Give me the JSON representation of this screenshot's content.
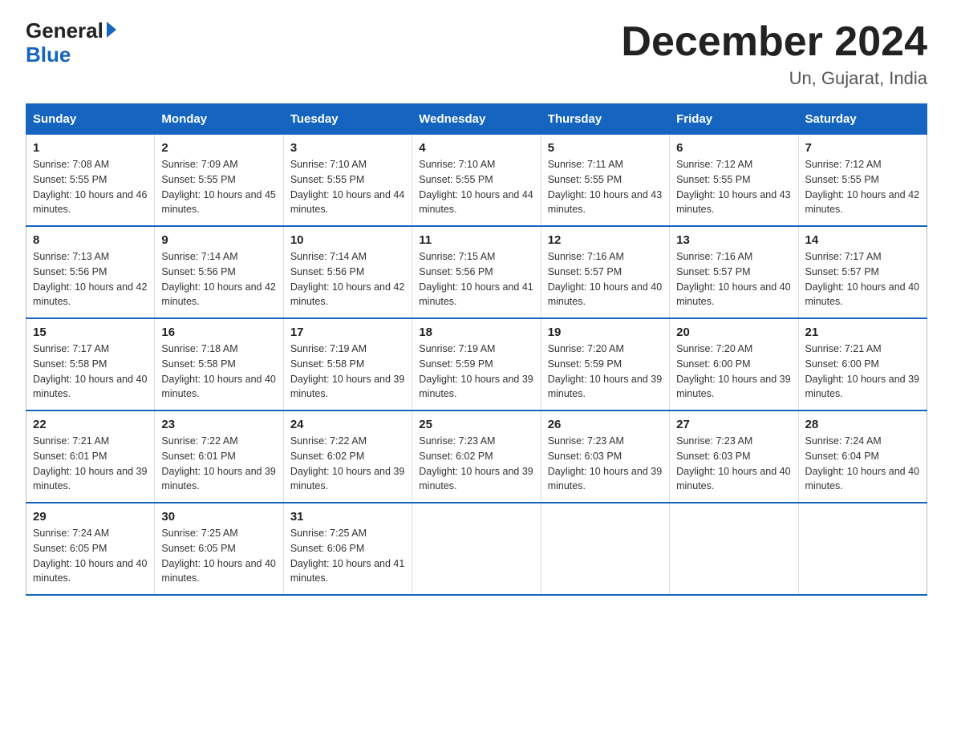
{
  "logo": {
    "general": "General",
    "blue": "Blue"
  },
  "title": "December 2024",
  "subtitle": "Un, Gujarat, India",
  "days_header": [
    "Sunday",
    "Monday",
    "Tuesday",
    "Wednesday",
    "Thursday",
    "Friday",
    "Saturday"
  ],
  "weeks": [
    [
      {
        "num": "1",
        "sunrise": "7:08 AM",
        "sunset": "5:55 PM",
        "daylight": "10 hours and 46 minutes."
      },
      {
        "num": "2",
        "sunrise": "7:09 AM",
        "sunset": "5:55 PM",
        "daylight": "10 hours and 45 minutes."
      },
      {
        "num": "3",
        "sunrise": "7:10 AM",
        "sunset": "5:55 PM",
        "daylight": "10 hours and 44 minutes."
      },
      {
        "num": "4",
        "sunrise": "7:10 AM",
        "sunset": "5:55 PM",
        "daylight": "10 hours and 44 minutes."
      },
      {
        "num": "5",
        "sunrise": "7:11 AM",
        "sunset": "5:55 PM",
        "daylight": "10 hours and 43 minutes."
      },
      {
        "num": "6",
        "sunrise": "7:12 AM",
        "sunset": "5:55 PM",
        "daylight": "10 hours and 43 minutes."
      },
      {
        "num": "7",
        "sunrise": "7:12 AM",
        "sunset": "5:55 PM",
        "daylight": "10 hours and 42 minutes."
      }
    ],
    [
      {
        "num": "8",
        "sunrise": "7:13 AM",
        "sunset": "5:56 PM",
        "daylight": "10 hours and 42 minutes."
      },
      {
        "num": "9",
        "sunrise": "7:14 AM",
        "sunset": "5:56 PM",
        "daylight": "10 hours and 42 minutes."
      },
      {
        "num": "10",
        "sunrise": "7:14 AM",
        "sunset": "5:56 PM",
        "daylight": "10 hours and 42 minutes."
      },
      {
        "num": "11",
        "sunrise": "7:15 AM",
        "sunset": "5:56 PM",
        "daylight": "10 hours and 41 minutes."
      },
      {
        "num": "12",
        "sunrise": "7:16 AM",
        "sunset": "5:57 PM",
        "daylight": "10 hours and 40 minutes."
      },
      {
        "num": "13",
        "sunrise": "7:16 AM",
        "sunset": "5:57 PM",
        "daylight": "10 hours and 40 minutes."
      },
      {
        "num": "14",
        "sunrise": "7:17 AM",
        "sunset": "5:57 PM",
        "daylight": "10 hours and 40 minutes."
      }
    ],
    [
      {
        "num": "15",
        "sunrise": "7:17 AM",
        "sunset": "5:58 PM",
        "daylight": "10 hours and 40 minutes."
      },
      {
        "num": "16",
        "sunrise": "7:18 AM",
        "sunset": "5:58 PM",
        "daylight": "10 hours and 40 minutes."
      },
      {
        "num": "17",
        "sunrise": "7:19 AM",
        "sunset": "5:58 PM",
        "daylight": "10 hours and 39 minutes."
      },
      {
        "num": "18",
        "sunrise": "7:19 AM",
        "sunset": "5:59 PM",
        "daylight": "10 hours and 39 minutes."
      },
      {
        "num": "19",
        "sunrise": "7:20 AM",
        "sunset": "5:59 PM",
        "daylight": "10 hours and 39 minutes."
      },
      {
        "num": "20",
        "sunrise": "7:20 AM",
        "sunset": "6:00 PM",
        "daylight": "10 hours and 39 minutes."
      },
      {
        "num": "21",
        "sunrise": "7:21 AM",
        "sunset": "6:00 PM",
        "daylight": "10 hours and 39 minutes."
      }
    ],
    [
      {
        "num": "22",
        "sunrise": "7:21 AM",
        "sunset": "6:01 PM",
        "daylight": "10 hours and 39 minutes."
      },
      {
        "num": "23",
        "sunrise": "7:22 AM",
        "sunset": "6:01 PM",
        "daylight": "10 hours and 39 minutes."
      },
      {
        "num": "24",
        "sunrise": "7:22 AM",
        "sunset": "6:02 PM",
        "daylight": "10 hours and 39 minutes."
      },
      {
        "num": "25",
        "sunrise": "7:23 AM",
        "sunset": "6:02 PM",
        "daylight": "10 hours and 39 minutes."
      },
      {
        "num": "26",
        "sunrise": "7:23 AM",
        "sunset": "6:03 PM",
        "daylight": "10 hours and 39 minutes."
      },
      {
        "num": "27",
        "sunrise": "7:23 AM",
        "sunset": "6:03 PM",
        "daylight": "10 hours and 40 minutes."
      },
      {
        "num": "28",
        "sunrise": "7:24 AM",
        "sunset": "6:04 PM",
        "daylight": "10 hours and 40 minutes."
      }
    ],
    [
      {
        "num": "29",
        "sunrise": "7:24 AM",
        "sunset": "6:05 PM",
        "daylight": "10 hours and 40 minutes."
      },
      {
        "num": "30",
        "sunrise": "7:25 AM",
        "sunset": "6:05 PM",
        "daylight": "10 hours and 40 minutes."
      },
      {
        "num": "31",
        "sunrise": "7:25 AM",
        "sunset": "6:06 PM",
        "daylight": "10 hours and 41 minutes."
      },
      null,
      null,
      null,
      null
    ]
  ]
}
